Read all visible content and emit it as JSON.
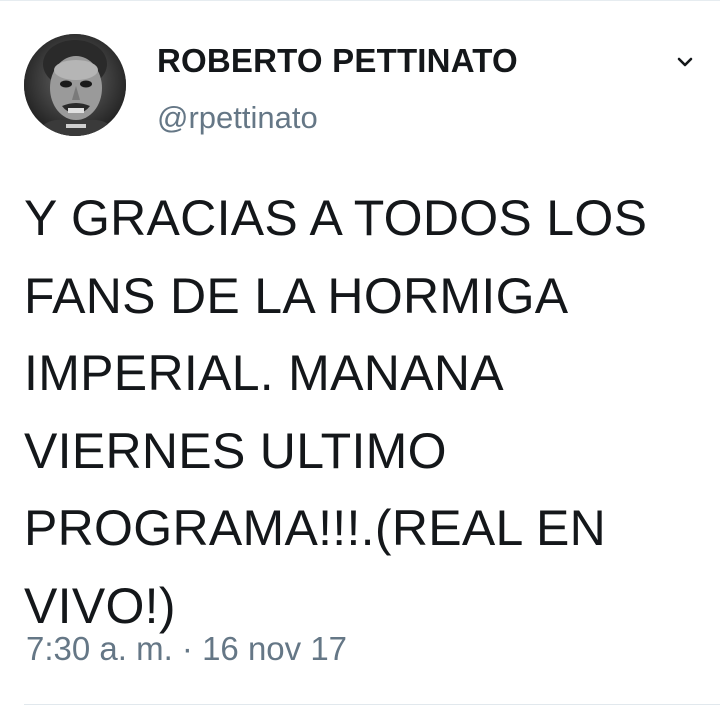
{
  "tweet": {
    "author": {
      "display_name": "ROBERTO PETTINATO",
      "handle": "@rpettinato",
      "avatar_icon": "profile-photo"
    },
    "text": "Y GRACIAS A TODOS LOS\nFANS DE LA HORMIGA\nIMPERIAL. MANANA\nVIERNES ULTIMO\nPROGRAMA!!!.(REAL EN\nVIVO!)",
    "timestamp": "7:30 a. m. · 16 nov 17",
    "menu_icon": "chevron-down-icon"
  },
  "colors": {
    "background": "#ffffff",
    "primary_text": "#14171a",
    "secondary_text": "#657786",
    "divider": "#e1e8ed"
  }
}
